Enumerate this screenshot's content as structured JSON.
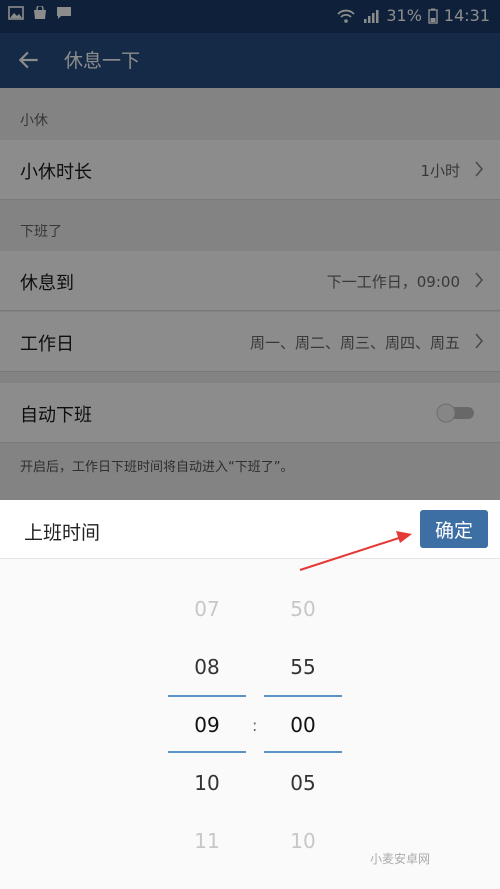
{
  "status_bar": {
    "battery": "31%",
    "time": "14:31",
    "icons_left": [
      "image-icon",
      "bag-icon",
      "chat-icon"
    ]
  },
  "app_bar": {
    "title": "休息一下",
    "back_icon": "arrow-left-icon"
  },
  "sections": {
    "short_break": {
      "label": "小休",
      "duration_label": "小休时长",
      "duration_value": "1小时"
    },
    "off_work": {
      "label": "下班了",
      "rest_until_label": "休息到",
      "rest_until_value": "下一工作日，09:00",
      "workdays_label": "工作日",
      "workdays_value": "周一、周二、周三、周四、周五",
      "auto_off_label": "自动下班",
      "auto_off_enabled": false,
      "hint": "开启后，工作日下班时间将自动进入“下班了”。"
    }
  },
  "sheet": {
    "title": "上班时间",
    "confirm_label": "确定",
    "hours": [
      "07",
      "08",
      "09",
      "10",
      "11"
    ],
    "minutes": [
      "50",
      "55",
      "00",
      "05",
      "10"
    ],
    "selected_hour": "09",
    "selected_minute": "00",
    "separator": ":"
  },
  "colors": {
    "app_bar": "#264d82",
    "status_bar": "#1d3d6b",
    "accent": "#3e6fa4",
    "annotation_arrow": "#e53935"
  },
  "watermark": "小麦安卓网"
}
